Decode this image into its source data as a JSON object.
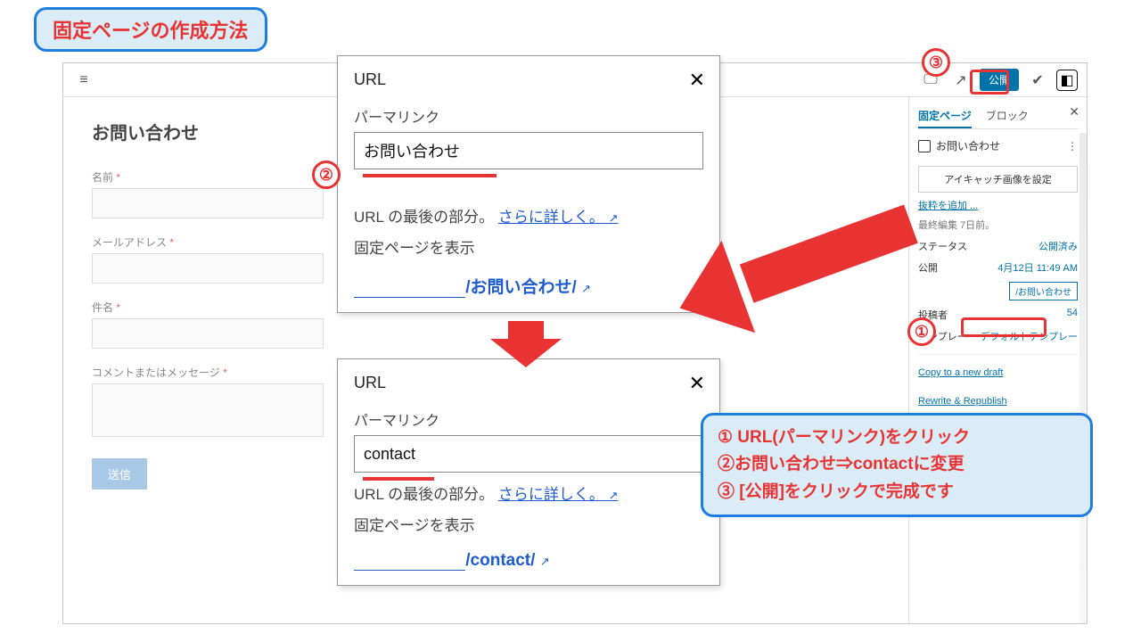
{
  "callout_title": "固定ページの作成方法",
  "editor": {
    "page_title": "お問い合わせ",
    "form": {
      "name_label": "名前",
      "email_label": "メールアドレス",
      "subject_label": "件名",
      "message_label": "コメントまたはメッセージ",
      "required_mark": "*",
      "submit": "送信"
    },
    "topbar": {
      "publish": "公開"
    }
  },
  "settings": {
    "tab_page": "固定ページ",
    "tab_block": "ブロック",
    "doc_title": "お問い合わせ",
    "featured_btn": "アイキャッチ画像を設定",
    "add_excerpt": "抜粋を追加 ...",
    "last_edit": "最終編集 7日前。",
    "status_label": "ステータス",
    "status_value": "公開済み",
    "publish_label": "公開",
    "publish_value": "4月12日 11:49 AM",
    "permalink_value": "/お問い合わせ",
    "author_label": "投稿者",
    "author_value": "54",
    "template_label": "テンプレー",
    "template_value": "デフォルトテンプレー",
    "copy_draft": "Copy to a new draft",
    "rewrite": "Rewrite & Republish"
  },
  "panel1": {
    "title": "URL",
    "label": "パーマリンク",
    "value": "お問い合わせ",
    "help_prefix": "URL の最後の部分。",
    "help_link": "さらに詳しく。",
    "view_text": "固定ページを表示",
    "preview_path": "/お問い合わせ/"
  },
  "panel2": {
    "title": "URL",
    "label": "パーマリンク",
    "value": "contact",
    "help_prefix": "URL の最後の部分。",
    "help_link": "さらに詳しく。",
    "view_text": "固定ページを表示",
    "preview_path": "/contact/"
  },
  "steps": {
    "s1": "①",
    "s2": "②",
    "s3": "③",
    "line1": "① URL(パーマリンク)をクリック",
    "line2": "②お問い合わせ⇒contactに変更",
    "line3": "③ [公開]をクリックで完成です"
  },
  "glyphs": {
    "external": "↗",
    "close": "✕",
    "kebab": "⋮"
  }
}
